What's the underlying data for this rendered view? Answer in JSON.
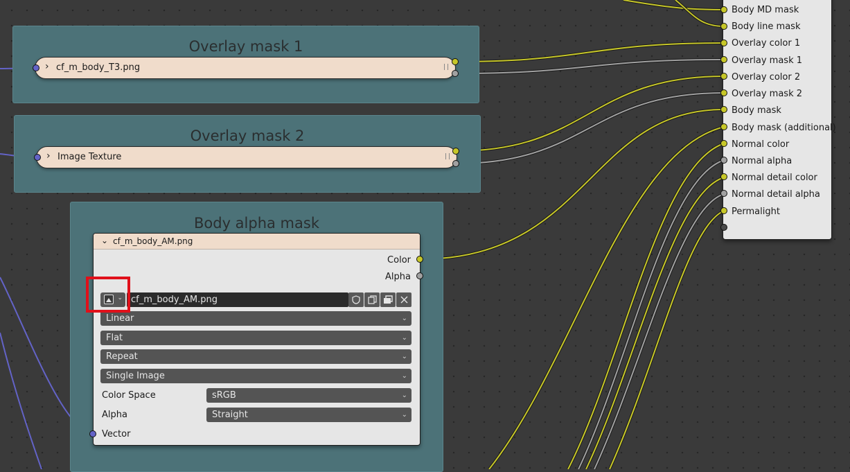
{
  "frames": {
    "overlay_mask_1": {
      "title": "Overlay mask 1",
      "node_label": "cf_m_body_T3.png"
    },
    "overlay_mask_2": {
      "title": "Overlay mask 2",
      "node_label": "Image Texture"
    },
    "body_alpha_mask": {
      "title": "Body alpha mask"
    }
  },
  "image_node": {
    "header": "cf_m_body_AM.png",
    "outputs": [
      "Color",
      "Alpha"
    ],
    "image_name": "cf_m_body_AM.png",
    "interpolation": "Linear",
    "projection": "Flat",
    "extension": "Repeat",
    "source": "Single Image",
    "color_space_label": "Color Space",
    "color_space_value": "sRGB",
    "alpha_label": "Alpha",
    "alpha_value": "Straight",
    "vector_label": "Vector",
    "browse_icon": "image-browse-icon",
    "buttons": [
      "fake-user-icon",
      "duplicate-icon",
      "open-icon",
      "close-icon"
    ]
  },
  "group_inputs": [
    {
      "label": "Body MD mask",
      "type": "color"
    },
    {
      "label": "Body line mask",
      "type": "color"
    },
    {
      "label": "Overlay color 1",
      "type": "color"
    },
    {
      "label": "Overlay mask 1",
      "type": "color"
    },
    {
      "label": "Overlay color 2",
      "type": "color"
    },
    {
      "label": "Overlay mask 2",
      "type": "color"
    },
    {
      "label": "Body mask",
      "type": "color"
    },
    {
      "label": "Body mask (additional)",
      "type": "color"
    },
    {
      "label": "Normal color",
      "type": "color"
    },
    {
      "label": "Normal alpha",
      "type": "float"
    },
    {
      "label": "Normal detail color",
      "type": "color"
    },
    {
      "label": "Normal detail alpha",
      "type": "float"
    },
    {
      "label": "Permalight",
      "type": "color"
    }
  ],
  "colors": {
    "wire_color": "#c7c729",
    "wire_float": "#a1a1a1",
    "wire_vector": "#6363c7",
    "frame": "#4c7278",
    "highlight": "#e0101a"
  }
}
